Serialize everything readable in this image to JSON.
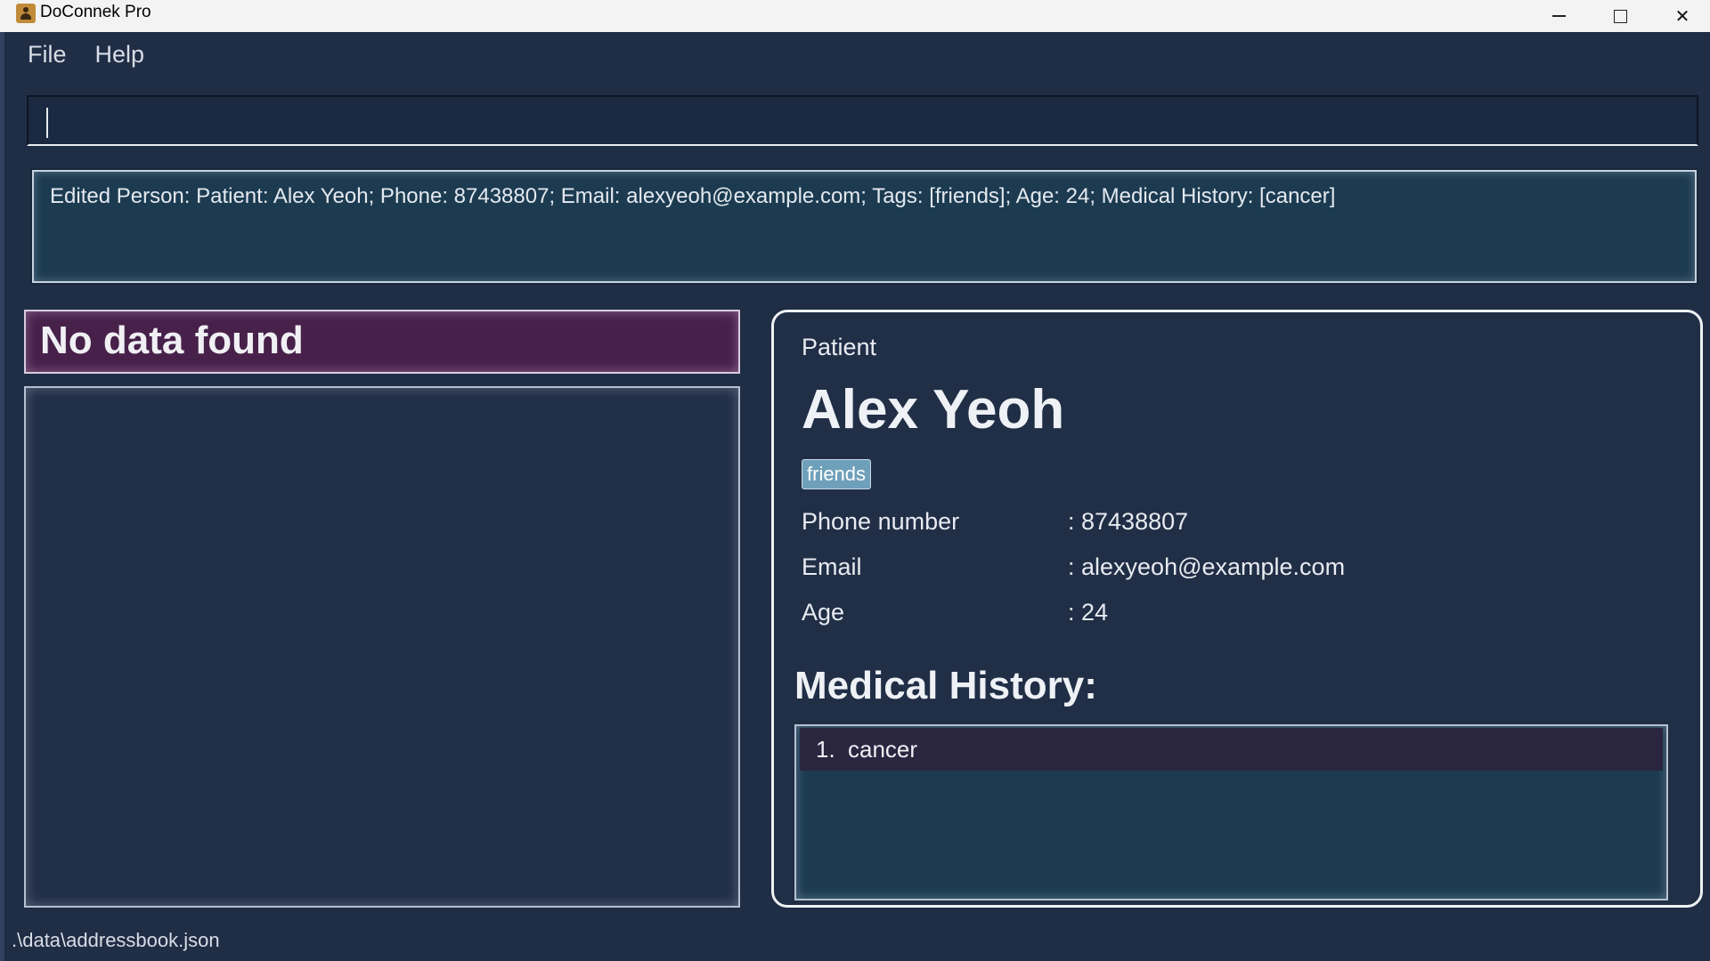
{
  "window": {
    "title": "DoConnek Pro",
    "icon": "address-book-icon"
  },
  "menu": {
    "items": [
      "File",
      "Help"
    ]
  },
  "command": {
    "value": "",
    "placeholder": ""
  },
  "result": {
    "text": "Edited Person: Patient: Alex Yeoh; Phone: 87438807; Email: alexyeoh@example.com; Tags: [friends]; Age: 24; Medical History: [cancer]"
  },
  "list_panel": {
    "banner": "No data found",
    "items": []
  },
  "detail": {
    "role": "Patient",
    "name": "Alex Yeoh",
    "tags": [
      "friends"
    ],
    "fields": [
      {
        "label": "Phone number",
        "value": ": 87438807"
      },
      {
        "label": "Email",
        "value": ": alexyeoh@example.com"
      },
      {
        "label": "Age",
        "value": ": 24"
      }
    ],
    "history_heading": "Medical History:",
    "history": [
      {
        "num": "1.",
        "text": "cancer"
      }
    ]
  },
  "status": {
    "path": ".\\data\\addressbook.json"
  },
  "colors": {
    "background": "#1f2d45",
    "result_background": "#1c3b51",
    "banner_background": "#47214a",
    "tag_background": "#6fa0ba"
  }
}
